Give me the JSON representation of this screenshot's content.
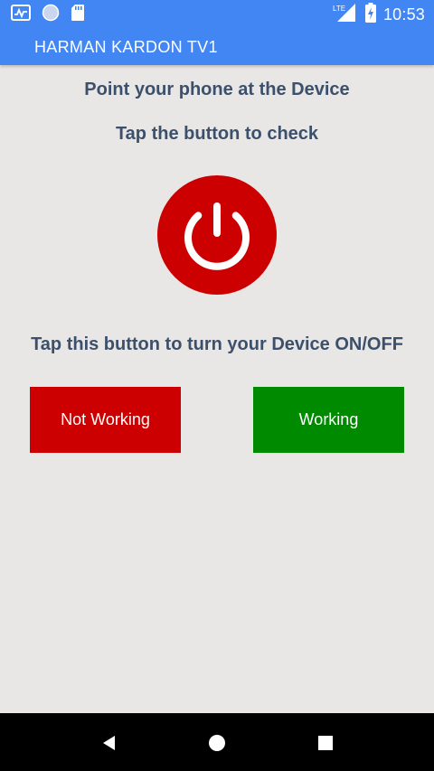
{
  "status_bar": {
    "time": "10:53",
    "network": "LTE",
    "icons": [
      "activity-icon",
      "circle-icon",
      "sd-card-icon",
      "signal-icon",
      "battery-charging-icon"
    ]
  },
  "app_bar": {
    "title": "HARMAN KARDON TV1"
  },
  "main": {
    "instruction_1": "Point your phone at the Device",
    "instruction_2": "Tap the button to check",
    "power_icon": "power-icon",
    "instruction_3": "Tap this button to turn your Device ON/OFF",
    "not_working_label": "Not Working",
    "working_label": "Working"
  },
  "nav_bar": {
    "icons": [
      "back-icon",
      "home-icon",
      "recents-icon"
    ]
  },
  "colors": {
    "primary": "#4286f4",
    "background": "#e9e7e5",
    "text": "#3c506b",
    "power_red": "#cc0000",
    "working_green": "#008a00"
  }
}
